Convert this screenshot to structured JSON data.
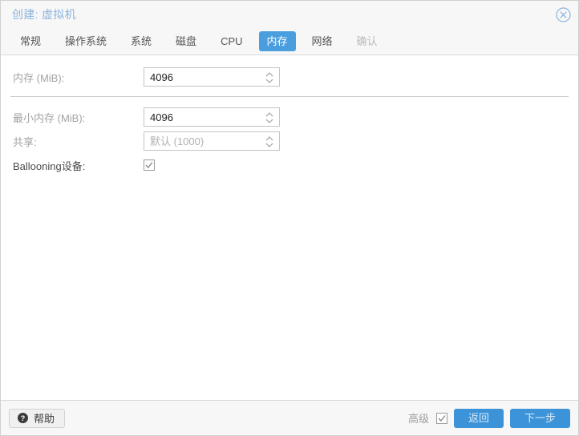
{
  "window": {
    "title": "创建: 虚拟机",
    "close_icon": "close-circle-icon"
  },
  "tabs": [
    {
      "label": "常规",
      "state": "normal"
    },
    {
      "label": "操作系统",
      "state": "normal"
    },
    {
      "label": "系统",
      "state": "normal"
    },
    {
      "label": "磁盘",
      "state": "normal"
    },
    {
      "label": "CPU",
      "state": "normal"
    },
    {
      "label": "内存",
      "state": "active"
    },
    {
      "label": "网络",
      "state": "normal"
    },
    {
      "label": "确认",
      "state": "disabled"
    }
  ],
  "form": {
    "memory": {
      "label": "内存 (MiB):",
      "value": "4096",
      "placeholder": ""
    },
    "min_memory": {
      "label": "最小内存 (MiB):",
      "value": "4096",
      "placeholder": ""
    },
    "shares": {
      "label": "共享:",
      "value": "",
      "placeholder": "默认 (1000)"
    },
    "ballooning": {
      "label": "Ballooning设备:",
      "checked": true
    }
  },
  "footer": {
    "help_label": "帮助",
    "help_icon": "question-circle-icon",
    "advanced_label": "高级",
    "advanced_checked": true,
    "back_label": "返回",
    "next_label": "下一步"
  },
  "colors": {
    "accent": "#4a9ede",
    "button_blue": "#3d93d8",
    "title_blue": "#8ab4dd",
    "label_gray": "#a3a3a3",
    "chrome_bg": "#f7f7f7"
  }
}
